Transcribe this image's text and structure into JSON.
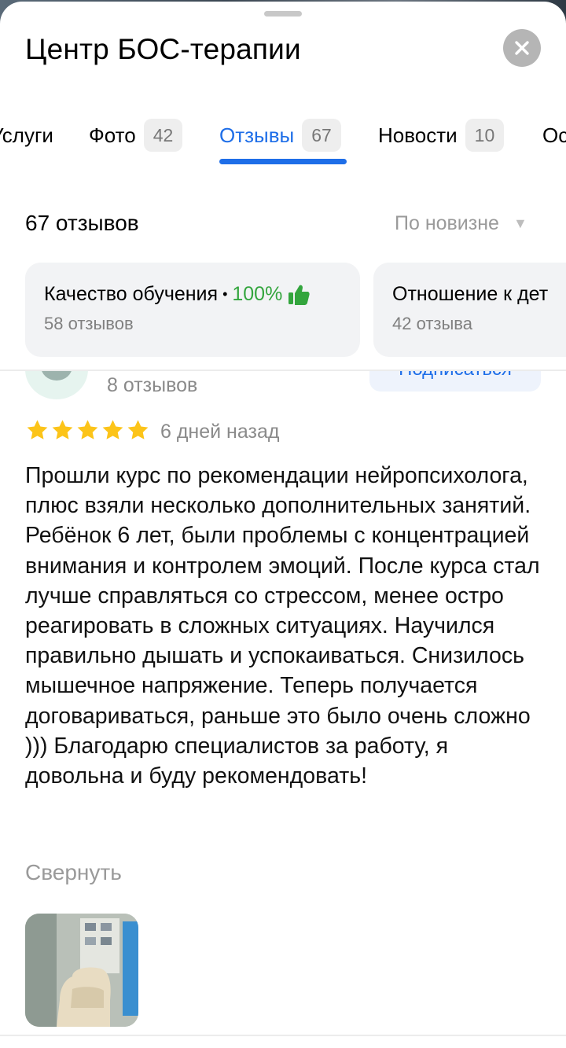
{
  "header": {
    "title": "Центр БОС-терапии",
    "close_icon": "close-icon"
  },
  "tabs": [
    {
      "label": "Услуги",
      "count": null,
      "active": false
    },
    {
      "label": "Фото",
      "count": "42",
      "active": false
    },
    {
      "label": "Отзывы",
      "count": "67",
      "active": true
    },
    {
      "label": "Новости",
      "count": "10",
      "active": false
    },
    {
      "label": "Ос",
      "count": null,
      "active": false
    }
  ],
  "reviews_header": {
    "count_label": "67 отзывов",
    "sort_label": "По новизне",
    "sort_icon": "caret-down-icon"
  },
  "aspects": [
    {
      "name": "Качество обучения",
      "separator": "•",
      "percent": "100%",
      "icon": "thumbs-up-icon",
      "reviews": "58 отзывов"
    },
    {
      "name": "Отношение к дет",
      "reviews": "42 отзыва"
    }
  ],
  "review": {
    "author_reviews": "8 отзывов",
    "subscribe_label": "Подписаться",
    "rating": 5,
    "date": "6 дней назад",
    "text": "Прошли курс по рекомендации нейропсихолога, плюс взяли несколько дополнительных занятий. Ребёнок 6 лет, были проблемы с концентрацией внимания и контролем эмоций. После курса стал лучше справляться со стрессом, менее остро реагировать в сложных ситуациях. Научился правильно дышать и успокаиваться. Снизилось мышечное напряжение. Теперь получается договариваться, раньше это было очень сложно ))) Благодарю специалистов за работу, я довольна и буду рекомендовать!",
    "collapse_label": "Свернуть"
  },
  "colors": {
    "accent": "#1e6ee8",
    "positive": "#33a53d",
    "star": "#fcc419",
    "muted": "#8a8a8a"
  }
}
